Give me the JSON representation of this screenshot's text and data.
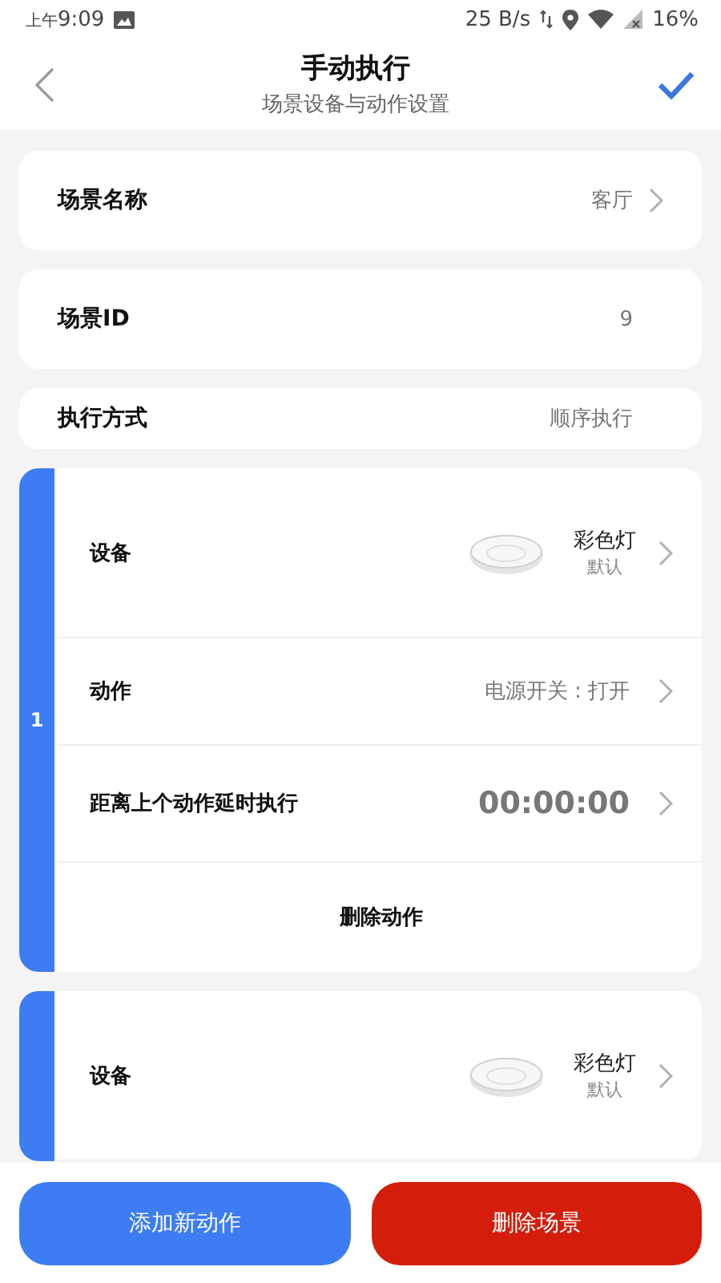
{
  "status_bar": {
    "time_prefix": "上午",
    "time": "9:09",
    "speed": "25 B/s",
    "battery": "16%"
  },
  "header": {
    "title": "手动执行",
    "subtitle": "场景设备与动作设置"
  },
  "settings": [
    {
      "label": "场景名称",
      "value": "客厅",
      "chevron": true,
      "kind": "row"
    },
    {
      "label": "场景ID",
      "value": "9",
      "chevron": false,
      "kind": "row"
    },
    {
      "label": "执行方式",
      "value": "顺序执行",
      "chevron": false,
      "kind": "short"
    }
  ],
  "actions": [
    {
      "index": "1",
      "rows": [
        {
          "kind": "device",
          "label": "设备",
          "value": "彩色灯",
          "sub": "默认"
        },
        {
          "kind": "action",
          "label": "动作",
          "value": "电源开关 : 打开"
        },
        {
          "kind": "delay",
          "label": "距离上个动作延时执行",
          "value": "00:00:00"
        },
        {
          "kind": "delete",
          "label": "删除动作"
        }
      ]
    },
    {
      "rows": [
        {
          "kind": "device",
          "label": "设备",
          "value": "彩色灯",
          "sub": "默认"
        }
      ]
    }
  ],
  "buttons": [
    {
      "label": "添加新动作",
      "kind": "primary"
    },
    {
      "label": "删除场景",
      "kind": "danger"
    }
  ]
}
